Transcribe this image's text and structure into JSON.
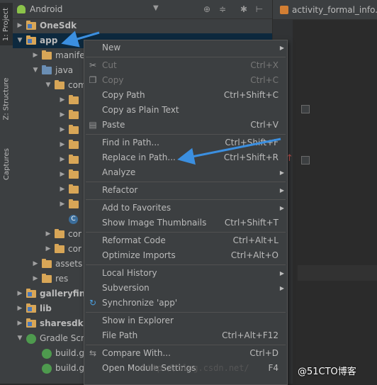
{
  "tool_strip": {
    "project_tab": "1: Project",
    "structure_tab": "Z: Structure",
    "captures_tab": "Captures"
  },
  "project_panel": {
    "view_selector": "Android",
    "tree": [
      {
        "label": "OneSdk",
        "bold": true,
        "icon": "folder-module-icon"
      },
      {
        "label": "app",
        "bold": true,
        "icon": "folder-module-icon",
        "selected": true
      },
      {
        "label": "manife",
        "icon": "folder-icon"
      },
      {
        "label": "java",
        "icon": "folder-blue-icon"
      },
      {
        "label": "com",
        "icon": "folder-icon"
      },
      {
        "label": "",
        "icon": "folder-icon"
      },
      {
        "label": "",
        "icon": "folder-icon"
      },
      {
        "label": "",
        "icon": "folder-icon"
      },
      {
        "label": "",
        "icon": "folder-icon"
      },
      {
        "label": "",
        "icon": "folder-icon"
      },
      {
        "label": "",
        "icon": "folder-icon"
      },
      {
        "label": "",
        "icon": "folder-icon"
      },
      {
        "label": "",
        "icon": "folder-icon"
      },
      {
        "label": "",
        "icon": "class-icon"
      },
      {
        "label": "cor",
        "icon": "folder-icon"
      },
      {
        "label": "cor",
        "icon": "folder-icon"
      },
      {
        "label": "assets",
        "icon": "folder-icon"
      },
      {
        "label": "res",
        "icon": "folder-icon"
      },
      {
        "label": "galleryfin",
        "bold": true,
        "icon": "folder-module-icon"
      },
      {
        "label": "lib",
        "bold": true,
        "icon": "folder-module-icon"
      },
      {
        "label": "sharesdk",
        "bold": true,
        "icon": "folder-module-icon"
      },
      {
        "label": "Gradle Scr",
        "icon": "gradle-icon"
      },
      {
        "label": "build.g",
        "icon": "gradle-file-icon"
      },
      {
        "label": "build.g",
        "icon": "gradle-file-icon"
      }
    ]
  },
  "editor": {
    "tab_title": "activity_formal_info.x"
  },
  "context_menu": {
    "items": [
      {
        "label": "New",
        "shortcut": "",
        "submenu": true
      },
      {
        "label": "Cut",
        "shortcut": "Ctrl+X",
        "disabled": true,
        "icon": "scissors-icon"
      },
      {
        "label": "Copy",
        "shortcut": "Ctrl+C",
        "disabled": true,
        "icon": "copy-icon"
      },
      {
        "label": "Copy Path",
        "shortcut": "Ctrl+Shift+C"
      },
      {
        "label": "Copy as Plain Text",
        "shortcut": ""
      },
      {
        "label": "Paste",
        "shortcut": "Ctrl+V",
        "icon": "paste-icon"
      },
      {
        "label": "Find in Path...",
        "shortcut": "Ctrl+Shift+F"
      },
      {
        "label": "Replace in Path...",
        "shortcut": "Ctrl+Shift+R"
      },
      {
        "label": "Analyze",
        "shortcut": "",
        "submenu": true
      },
      {
        "label": "Refactor",
        "shortcut": "",
        "submenu": true
      },
      {
        "label": "Add to Favorites",
        "shortcut": "",
        "submenu": true
      },
      {
        "label": "Show Image Thumbnails",
        "shortcut": "Ctrl+Shift+T"
      },
      {
        "label": "Reformat Code",
        "shortcut": "Ctrl+Alt+L"
      },
      {
        "label": "Optimize Imports",
        "shortcut": "Ctrl+Alt+O"
      },
      {
        "label": "Local History",
        "shortcut": "",
        "submenu": true
      },
      {
        "label": "Subversion",
        "shortcut": "",
        "submenu": true
      },
      {
        "label": "Synchronize 'app'",
        "shortcut": "",
        "icon": "sync-icon"
      },
      {
        "label": "Show in Explorer",
        "shortcut": ""
      },
      {
        "label": "File Path",
        "shortcut": "Ctrl+Alt+F12"
      },
      {
        "label": "Compare With...",
        "shortcut": "Ctrl+D",
        "icon": "compare-icon"
      },
      {
        "label": "Open Module Settings",
        "shortcut": "F4"
      }
    ]
  },
  "watermark": {
    "url": "http://blog.csdn.net/",
    "brand": "@51CTO博客"
  },
  "colors": {
    "background": "#2b2b2b",
    "panel": "#3c3f41",
    "selection": "#0d293e",
    "annotation_arrow": "#3b8fe0"
  }
}
